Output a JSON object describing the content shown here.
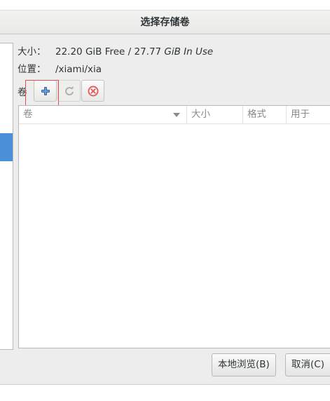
{
  "window": {
    "title": "选择存储卷"
  },
  "pool_info": {
    "size_label": "大小：",
    "size_value_prefix": "22.20 GiB Free / 27.77 ",
    "size_value_suffix": "GiB In Use",
    "location_label": "位置：",
    "location_value": "/xiami/xia"
  },
  "volumes": {
    "label": "卷",
    "toolbar": {
      "add_icon": "plus-icon",
      "refresh_icon": "refresh-icon",
      "delete_icon": "delete-icon"
    },
    "columns": [
      "卷",
      "大小",
      "格式",
      "用于"
    ],
    "rows": []
  },
  "buttons": {
    "browse_local": "本地浏览(B)",
    "cancel": "取消(C)"
  },
  "colors": {
    "selection": "#4a90d9",
    "highlight_box": "#e05050",
    "add_icon": "#3465a4",
    "delete_icon": "#e06060"
  }
}
